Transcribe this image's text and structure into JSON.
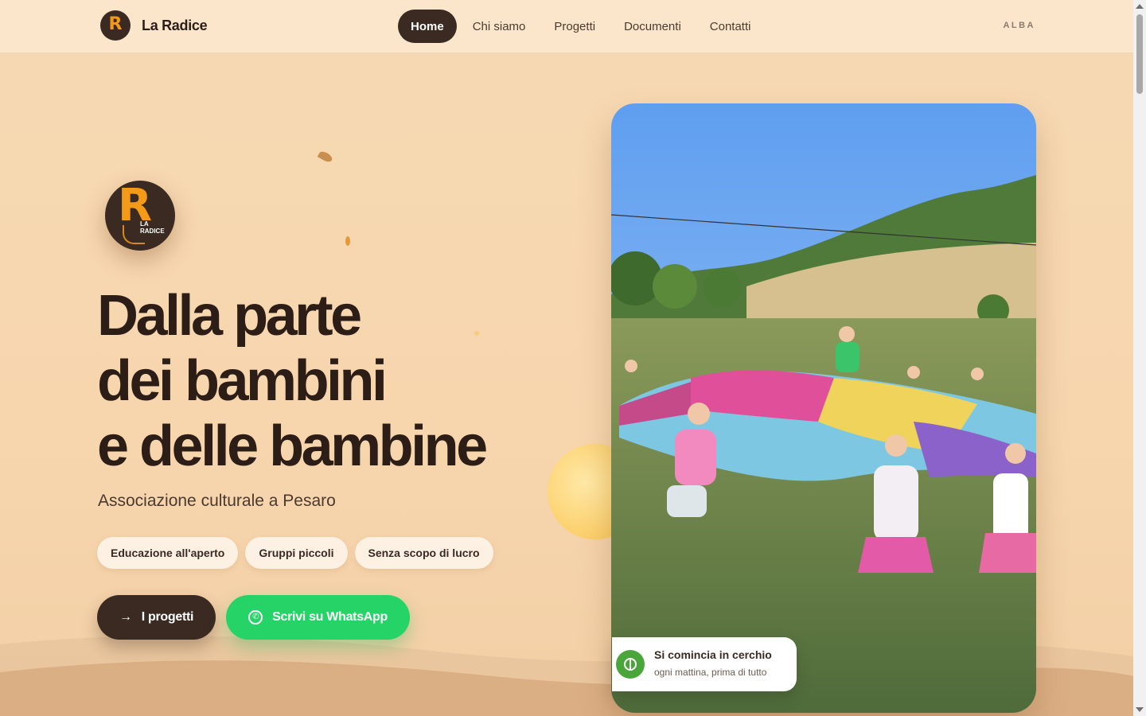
{
  "header": {
    "brand_name": "La Radice",
    "logo_letter": "R",
    "nav": [
      {
        "label": "Home",
        "active": true
      },
      {
        "label": "Chi siamo",
        "active": false
      },
      {
        "label": "Progetti",
        "active": false
      },
      {
        "label": "Documenti",
        "active": false
      },
      {
        "label": "Contatti",
        "active": false
      }
    ],
    "right_label": "ALBA"
  },
  "hero": {
    "logo_letter": "R",
    "logo_text": "LA RADICE",
    "headline": [
      "Dalla parte",
      "dei bambini",
      "e delle bambine"
    ],
    "subtitle": "Associazione culturale a Pesaro",
    "chips": [
      "Educazione all'aperto",
      "Gruppi piccoli",
      "Senza scopo di lucro"
    ],
    "cta_primary": "I progetti",
    "cta_primary_icon": "arrow-right-icon",
    "cta_secondary": "Scrivi su WhatsApp",
    "cta_secondary_icon": "whatsapp-icon",
    "photo_caption_title": "Si comincia in cerchio",
    "photo_caption_sub": "ogni mattina, prima di tutto",
    "photo_caption_icon": "circle-icon"
  },
  "colors": {
    "dark": "#3a2a22",
    "accent_orange": "#f39a19",
    "whatsapp_green": "#25d366",
    "background": "#f6d9b3"
  }
}
